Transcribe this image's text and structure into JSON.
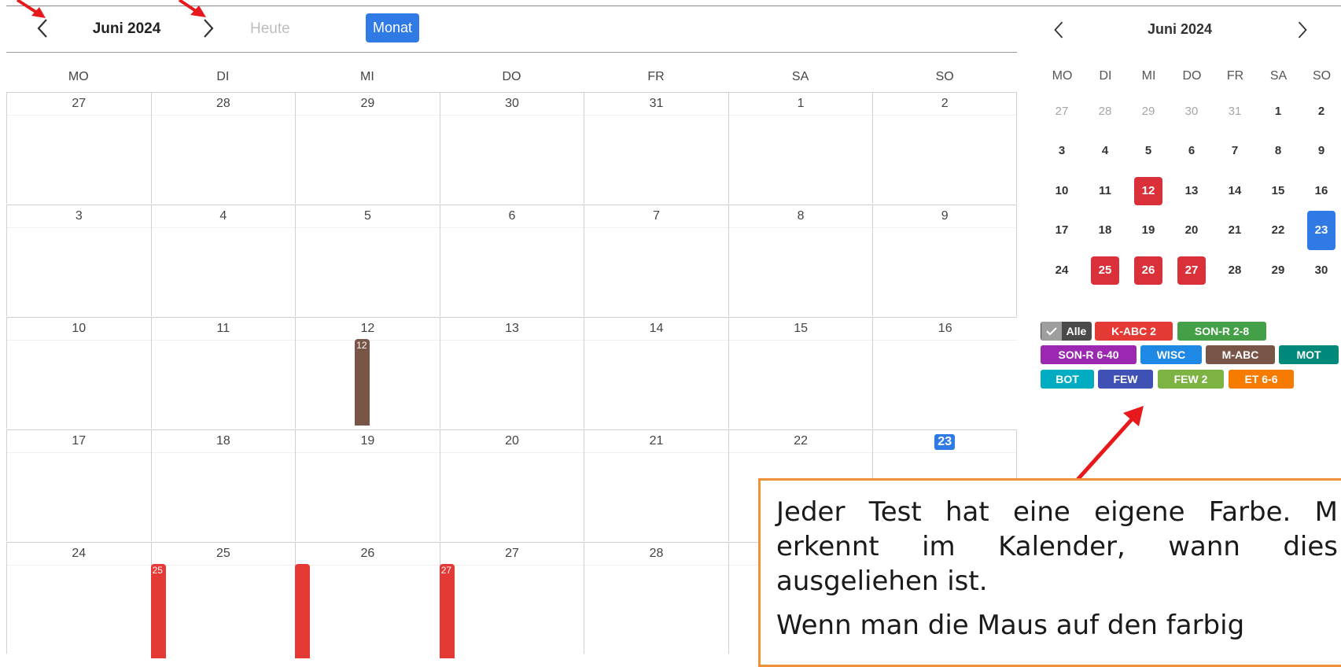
{
  "main_calendar": {
    "title": "Juni 2024",
    "today_label": "Heute",
    "view_label": "Monat",
    "weekdays": [
      "MO",
      "DI",
      "MI",
      "DO",
      "FR",
      "SA",
      "SO"
    ],
    "weeks": [
      [
        "27",
        "28",
        "29",
        "30",
        "31",
        "1",
        "2"
      ],
      [
        "3",
        "4",
        "5",
        "6",
        "7",
        "8",
        "9"
      ],
      [
        "10",
        "11",
        "12",
        "13",
        "14",
        "15",
        "16"
      ],
      [
        "17",
        "18",
        "19",
        "20",
        "21",
        "22",
        "23"
      ],
      [
        "24",
        "25",
        "26",
        "27",
        "28",
        "",
        ""
      ]
    ],
    "today": "23",
    "events": [
      {
        "label": "12",
        "color": "#795548"
      },
      {
        "label": "25",
        "color": "#e53935"
      },
      {
        "label": "",
        "color": "#e53935"
      },
      {
        "label": "27",
        "color": "#e53935"
      }
    ]
  },
  "mini_calendar": {
    "title": "Juni 2024",
    "weekdays": [
      "MO",
      "DI",
      "MI",
      "DO",
      "FR",
      "SA",
      "SO"
    ],
    "weeks": [
      [
        "27",
        "28",
        "29",
        "30",
        "31",
        "1",
        "2"
      ],
      [
        "3",
        "4",
        "5",
        "6",
        "7",
        "8",
        "9"
      ],
      [
        "10",
        "11",
        "12",
        "13",
        "14",
        "15",
        "16"
      ],
      [
        "17",
        "18",
        "19",
        "20",
        "21",
        "22",
        "23"
      ],
      [
        "24",
        "25",
        "26",
        "27",
        "28",
        "29",
        "30"
      ]
    ],
    "booked_days": [
      "12",
      "25",
      "26",
      "27"
    ],
    "today": "23"
  },
  "filters": {
    "all_label": "Alle",
    "chips": [
      {
        "label": "K-ABC 2",
        "color": "#e53935"
      },
      {
        "label": "SON-R 2-8",
        "color": "#43a047"
      },
      {
        "label": "SON-R 6-40",
        "color": "#9c27b0"
      },
      {
        "label": "WISC",
        "color": "#1e88e5"
      },
      {
        "label": "M-ABC",
        "color": "#795548"
      },
      {
        "label": "MOT",
        "color": "#00897b"
      },
      {
        "label": "BOT",
        "color": "#00acc1"
      },
      {
        "label": "FEW",
        "color": "#3f51b5"
      },
      {
        "label": "FEW 2",
        "color": "#7cb342"
      },
      {
        "label": "ET 6-6",
        "color": "#f57c00"
      }
    ]
  },
  "callout": {
    "paragraph1": "Jeder Test hat eine eigene Farbe. M erkennt im Kalender, wann dies ausgeliehen ist.",
    "paragraph2": "Wenn man die Maus auf den farbig"
  },
  "colors": {
    "accent": "#2f7ae5",
    "booked": "#d9303a",
    "callout_border": "#f0913a",
    "arrow": "#e8191c"
  }
}
